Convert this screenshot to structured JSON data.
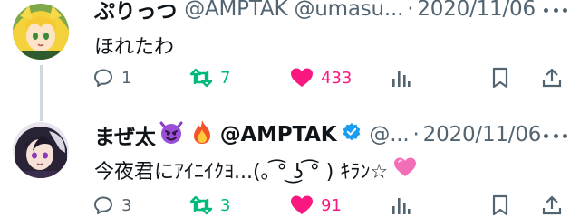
{
  "tweets": [
    {
      "display_name": "ぷりっつ",
      "handle_text": "@AMPTAK @umasu...",
      "separator": "·",
      "date": "2020/11/06",
      "text": "ほれたわ",
      "reply_count": "1",
      "retweet_count": "7",
      "like_count": "433",
      "liked": true,
      "avatar_icon": "blonde-character-avatar"
    },
    {
      "display_name": "まぜ太",
      "handle_text": "@AMPTAK",
      "handle_suffix": "@...",
      "separator": "·",
      "date": "2020/11/06",
      "text": "今夜君にｱｲﾆｲｸﾖ...(｡ ͡° ͜ʖ ͡° ) ｷﾗﾝ☆",
      "reply_count": "3",
      "retweet_count": "3",
      "like_count": "91",
      "liked": true,
      "avatar_icon": "dark-haired-character-avatar",
      "verified": true
    }
  ],
  "colors": {
    "text_primary": "#0f1419",
    "text_secondary": "#536471",
    "retweet_green": "#00ba7c",
    "like_pink": "#f91880",
    "verified_blue": "#1d9bf0"
  }
}
